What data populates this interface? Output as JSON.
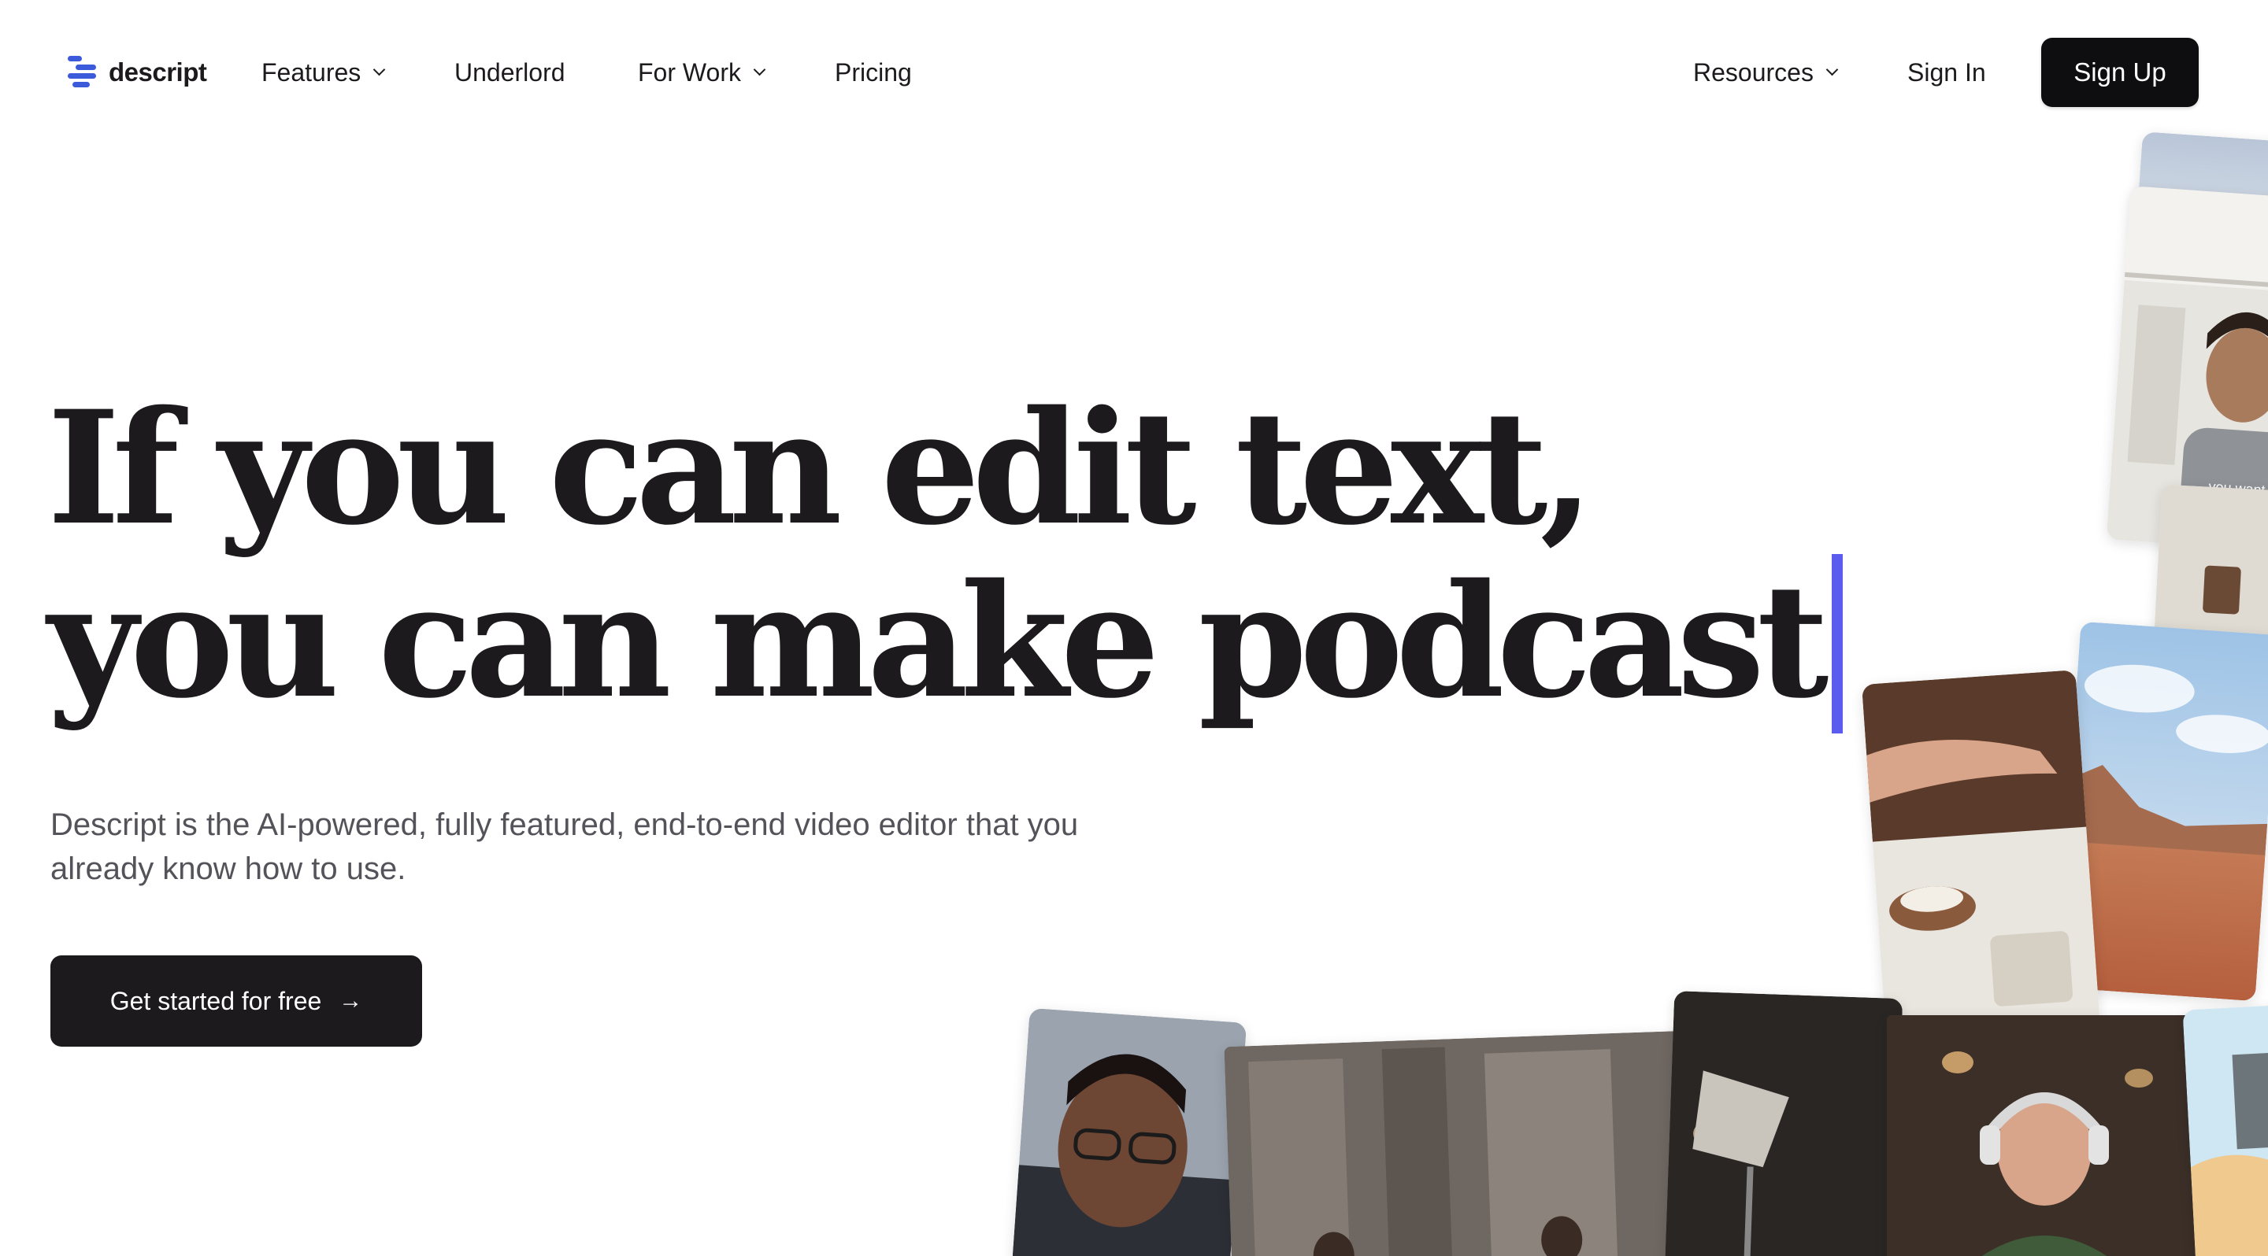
{
  "brand": {
    "name": "descript",
    "accent": "#3b5bdb"
  },
  "nav": {
    "items": [
      {
        "label": "Features",
        "dropdown": true
      },
      {
        "label": "Underlord",
        "dropdown": false
      },
      {
        "label": "For Work",
        "dropdown": true
      },
      {
        "label": "Pricing",
        "dropdown": false
      }
    ],
    "resources": {
      "label": "Resources",
      "dropdown": true
    },
    "sign_in": "Sign In",
    "sign_up": "Sign Up"
  },
  "hero": {
    "headline_line1": "If you can edit text,",
    "headline_line2": "you can make podcast",
    "caret_color": "#5b5bf0",
    "subtitle": "Descript is the AI-powered, fully featured, end-to-end video editor that you already know how to use.",
    "cta_label": "Get started for free",
    "cta_icon": "arrow-right-icon"
  },
  "collage": {
    "card_text": "you want."
  }
}
